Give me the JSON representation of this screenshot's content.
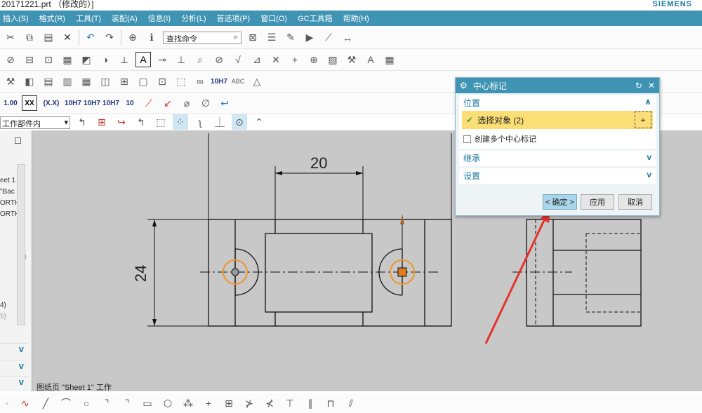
{
  "title": "20171221.prt （修改的）]",
  "brand": "SIEMENS",
  "menu": [
    "插入(S)",
    "格式(R)",
    "工具(T)",
    "装配(A)",
    "信息(I)",
    "分析(L)",
    "首选项(P)",
    "窗口(O)",
    "GC工具箱",
    "帮助(H)"
  ],
  "toolbar": {
    "search_placeholder": "查找命令",
    "tol_labels": [
      "1.00",
      "XX",
      "(X.X)",
      "10H7",
      "10H7",
      "10H7",
      "10"
    ],
    "filter_value": "工作部件内"
  },
  "left_panel": {
    "rows": [
      "eet 1",
      "\"Bac",
      "ORTH",
      "ORTH",
      "(0)",
      "4)",
      "5)"
    ]
  },
  "drawing": {
    "dim_horizontal": "20",
    "dim_vertical": "24",
    "status": "图纸页 \"Sheet 1\" 工作"
  },
  "dialog": {
    "title": "中心标记",
    "sections": {
      "position": "位置",
      "inherit": "继承",
      "settings": "设置"
    },
    "select_object": "选择对象 (2)",
    "create_multiple": "创建多个中心标记",
    "create_multiple_checked": false,
    "ok": "< 确定 >",
    "apply": "应用",
    "cancel": "取消"
  },
  "colors": {
    "menu": "#3f93b3",
    "highlight": "#fbde76",
    "marker": "#f0952a"
  }
}
